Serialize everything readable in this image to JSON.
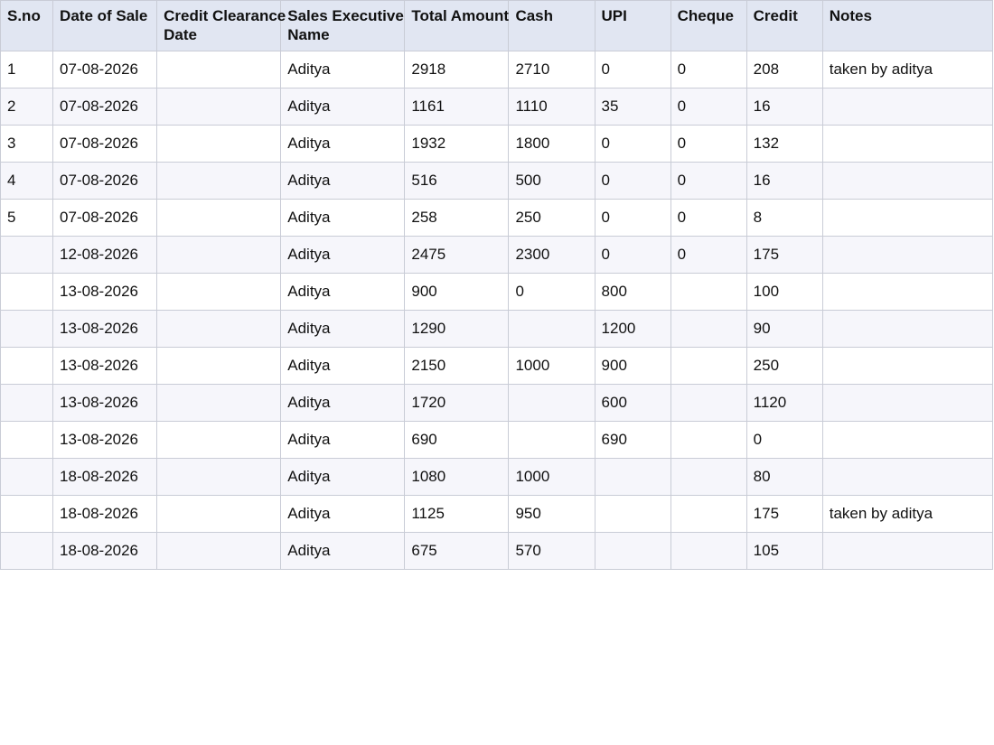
{
  "table": {
    "columns": [
      "S.no",
      "Date of Sale",
      "Credit Clearance Date",
      "Sales Executive Name",
      "Total Amount",
      "Cash",
      "UPI",
      "Cheque",
      "Credit",
      "Notes"
    ],
    "rows": [
      [
        "1",
        "07-08-2026",
        "",
        "Aditya",
        "2918",
        "2710",
        "0",
        "0",
        "208",
        "taken by aditya"
      ],
      [
        "2",
        "07-08-2026",
        "",
        "Aditya",
        "1161",
        "1110",
        "35",
        "0",
        "16",
        ""
      ],
      [
        "3",
        "07-08-2026",
        "",
        "Aditya",
        "1932",
        "1800",
        "0",
        "0",
        "132",
        ""
      ],
      [
        "4",
        "07-08-2026",
        "",
        "Aditya",
        "516",
        "500",
        "0",
        "0",
        "16",
        ""
      ],
      [
        "5",
        "07-08-2026",
        "",
        "Aditya",
        "258",
        "250",
        "0",
        "0",
        "8",
        ""
      ],
      [
        "",
        "12-08-2026",
        "",
        "Aditya",
        "2475",
        "2300",
        "0",
        "0",
        "175",
        ""
      ],
      [
        "",
        "13-08-2026",
        "",
        "Aditya",
        "900",
        "0",
        "800",
        "",
        "100",
        ""
      ],
      [
        "",
        "13-08-2026",
        "",
        "Aditya",
        "1290",
        "",
        "1200",
        "",
        "90",
        ""
      ],
      [
        "",
        "13-08-2026",
        "",
        "Aditya",
        "2150",
        "1000",
        "900",
        "",
        "250",
        ""
      ],
      [
        "",
        "13-08-2026",
        "",
        "Aditya",
        "1720",
        "",
        "600",
        "",
        "1120",
        ""
      ],
      [
        "",
        "13-08-2026",
        "",
        "Aditya",
        "690",
        "",
        "690",
        "",
        "0",
        ""
      ],
      [
        "",
        "18-08-2026",
        "",
        "Aditya",
        "1080",
        "1000",
        "",
        "",
        "80",
        ""
      ],
      [
        "",
        "18-08-2026",
        "",
        "Aditya",
        "1125",
        "950",
        "",
        "",
        "175",
        "taken by aditya"
      ],
      [
        "",
        "18-08-2026",
        "",
        "Aditya",
        "675",
        "570",
        "",
        "",
        "105",
        ""
      ]
    ]
  }
}
